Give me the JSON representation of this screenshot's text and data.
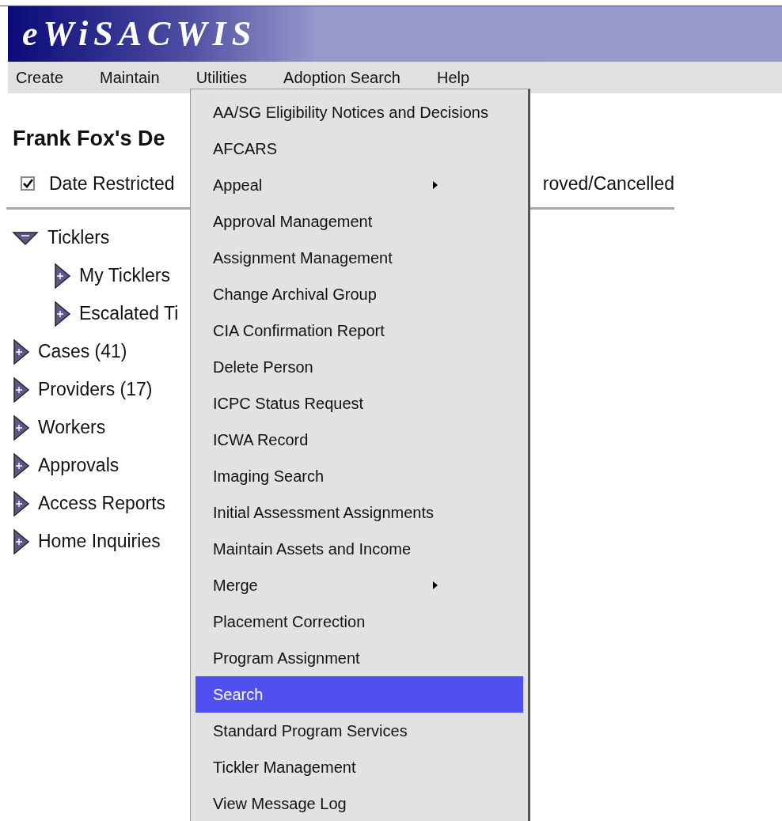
{
  "app": {
    "logo": "eWiSACWIS"
  },
  "menu_bar": [
    {
      "label": "Create"
    },
    {
      "label": "Maintain"
    },
    {
      "label": "Utilities"
    },
    {
      "label": "Adoption Search"
    },
    {
      "label": "Help"
    }
  ],
  "page": {
    "title": "Frank Fox's De",
    "filter": {
      "label": "Date Restricted",
      "checked": true
    },
    "filter_2": {
      "label": "roved/Cancelled"
    }
  },
  "tree": [
    {
      "label": "Ticklers",
      "expanded": true,
      "children": [
        {
          "label": "My Ticklers",
          "expanded": false
        },
        {
          "label": "Escalated Ti",
          "expanded": false
        }
      ]
    },
    {
      "label": "Cases (41)",
      "expanded": false
    },
    {
      "label": "Providers (17)",
      "expanded": false
    },
    {
      "label": "Workers",
      "expanded": false
    },
    {
      "label": "Approvals",
      "expanded": false
    },
    {
      "label": "Access Reports",
      "expanded": false
    },
    {
      "label": "Home Inquiries",
      "expanded": false
    }
  ],
  "dropdown": {
    "items": [
      {
        "label": "AA/SG Eligibility Notices and Decisions",
        "submenu": false,
        "selected": false
      },
      {
        "label": "AFCARS",
        "submenu": false,
        "selected": false
      },
      {
        "label": "Appeal",
        "submenu": true,
        "selected": false
      },
      {
        "label": "Approval Management",
        "submenu": false,
        "selected": false
      },
      {
        "label": "Assignment Management",
        "submenu": false,
        "selected": false
      },
      {
        "label": "Change Archival Group",
        "submenu": false,
        "selected": false
      },
      {
        "label": "CIA Confirmation Report",
        "submenu": false,
        "selected": false
      },
      {
        "label": "Delete Person",
        "submenu": false,
        "selected": false
      },
      {
        "label": "ICPC Status Request",
        "submenu": false,
        "selected": false
      },
      {
        "label": "ICWA Record",
        "submenu": false,
        "selected": false
      },
      {
        "label": "Imaging Search",
        "submenu": false,
        "selected": false
      },
      {
        "label": "Initial Assessment Assignments",
        "submenu": false,
        "selected": false
      },
      {
        "label": "Maintain Assets and Income",
        "submenu": false,
        "selected": false
      },
      {
        "label": "Merge",
        "submenu": true,
        "selected": false
      },
      {
        "label": "Placement Correction",
        "submenu": false,
        "selected": false
      },
      {
        "label": "Program Assignment",
        "submenu": false,
        "selected": false
      },
      {
        "label": "Search",
        "submenu": false,
        "selected": true
      },
      {
        "label": "Standard Program Services",
        "submenu": false,
        "selected": false
      },
      {
        "label": "Tickler Management",
        "submenu": false,
        "selected": false
      },
      {
        "label": "View Message Log",
        "submenu": false,
        "selected": false
      }
    ]
  }
}
